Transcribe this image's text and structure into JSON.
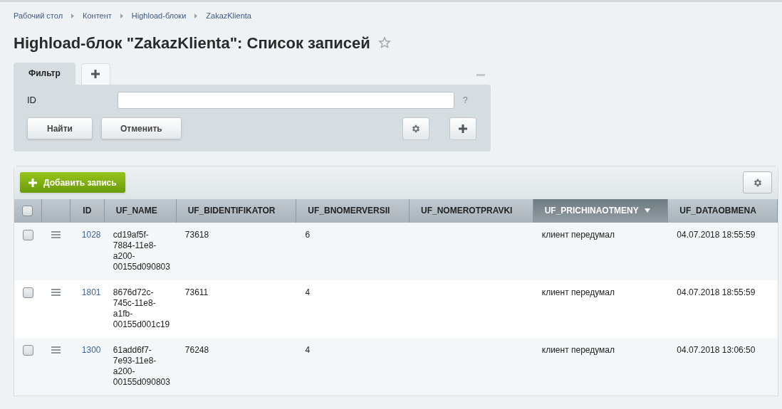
{
  "breadcrumbs": [
    "Рабочий стол",
    "Контент",
    "Highload-блоки",
    "ZakazKlienta"
  ],
  "title": "Highload-блок \"ZakazKlienta\": Список записей",
  "favorite": false,
  "filter": {
    "tabs": [
      {
        "label": "Фильтр",
        "selected": true
      }
    ],
    "fields": [
      {
        "label": "ID",
        "hint": "?"
      }
    ],
    "buttons": [
      "Найти",
      "Отменить"
    ]
  },
  "toolbar": {
    "add_button": "Добавить запись"
  },
  "table": {
    "columns": [
      {
        "label": "ID",
        "selected": false
      },
      {
        "label": "UF_NAME",
        "selected": false
      },
      {
        "label": "UF_BIDENTIFIKATOR",
        "selected": false
      },
      {
        "label": "UF_BNOMERVERSII",
        "selected": false
      },
      {
        "label": "UF_NOMEROTPRAVKI",
        "selected": false
      },
      {
        "label": "UF_PRICHINAOTMENY",
        "selected": true
      },
      {
        "label": "UF_DATAOBMENA",
        "selected": false
      }
    ],
    "rows": [
      {
        "checked": false,
        "cells": [
          "1028",
          "cd19af5f-\n7884-11e8-\na200-\n00155d090803",
          "73618",
          "6",
          "",
          "клиент передумал",
          "04.07.2018 18:55:59"
        ]
      },
      {
        "checked": false,
        "cells": [
          "1801",
          "8676d72c-\n745c-11e8-\na1fb-\n00155d001c19",
          "73611",
          "4",
          "",
          "клиент передумал",
          "04.07.2018 18:55:59"
        ]
      },
      {
        "checked": false,
        "cells": [
          "1300",
          "61add6f7-\n7e93-11e8-\na200-\n00155d090803",
          "76248",
          "4",
          "",
          "клиент передумал",
          "04.07.2018 13:06:50"
        ]
      }
    ],
    "all_checked": false
  }
}
